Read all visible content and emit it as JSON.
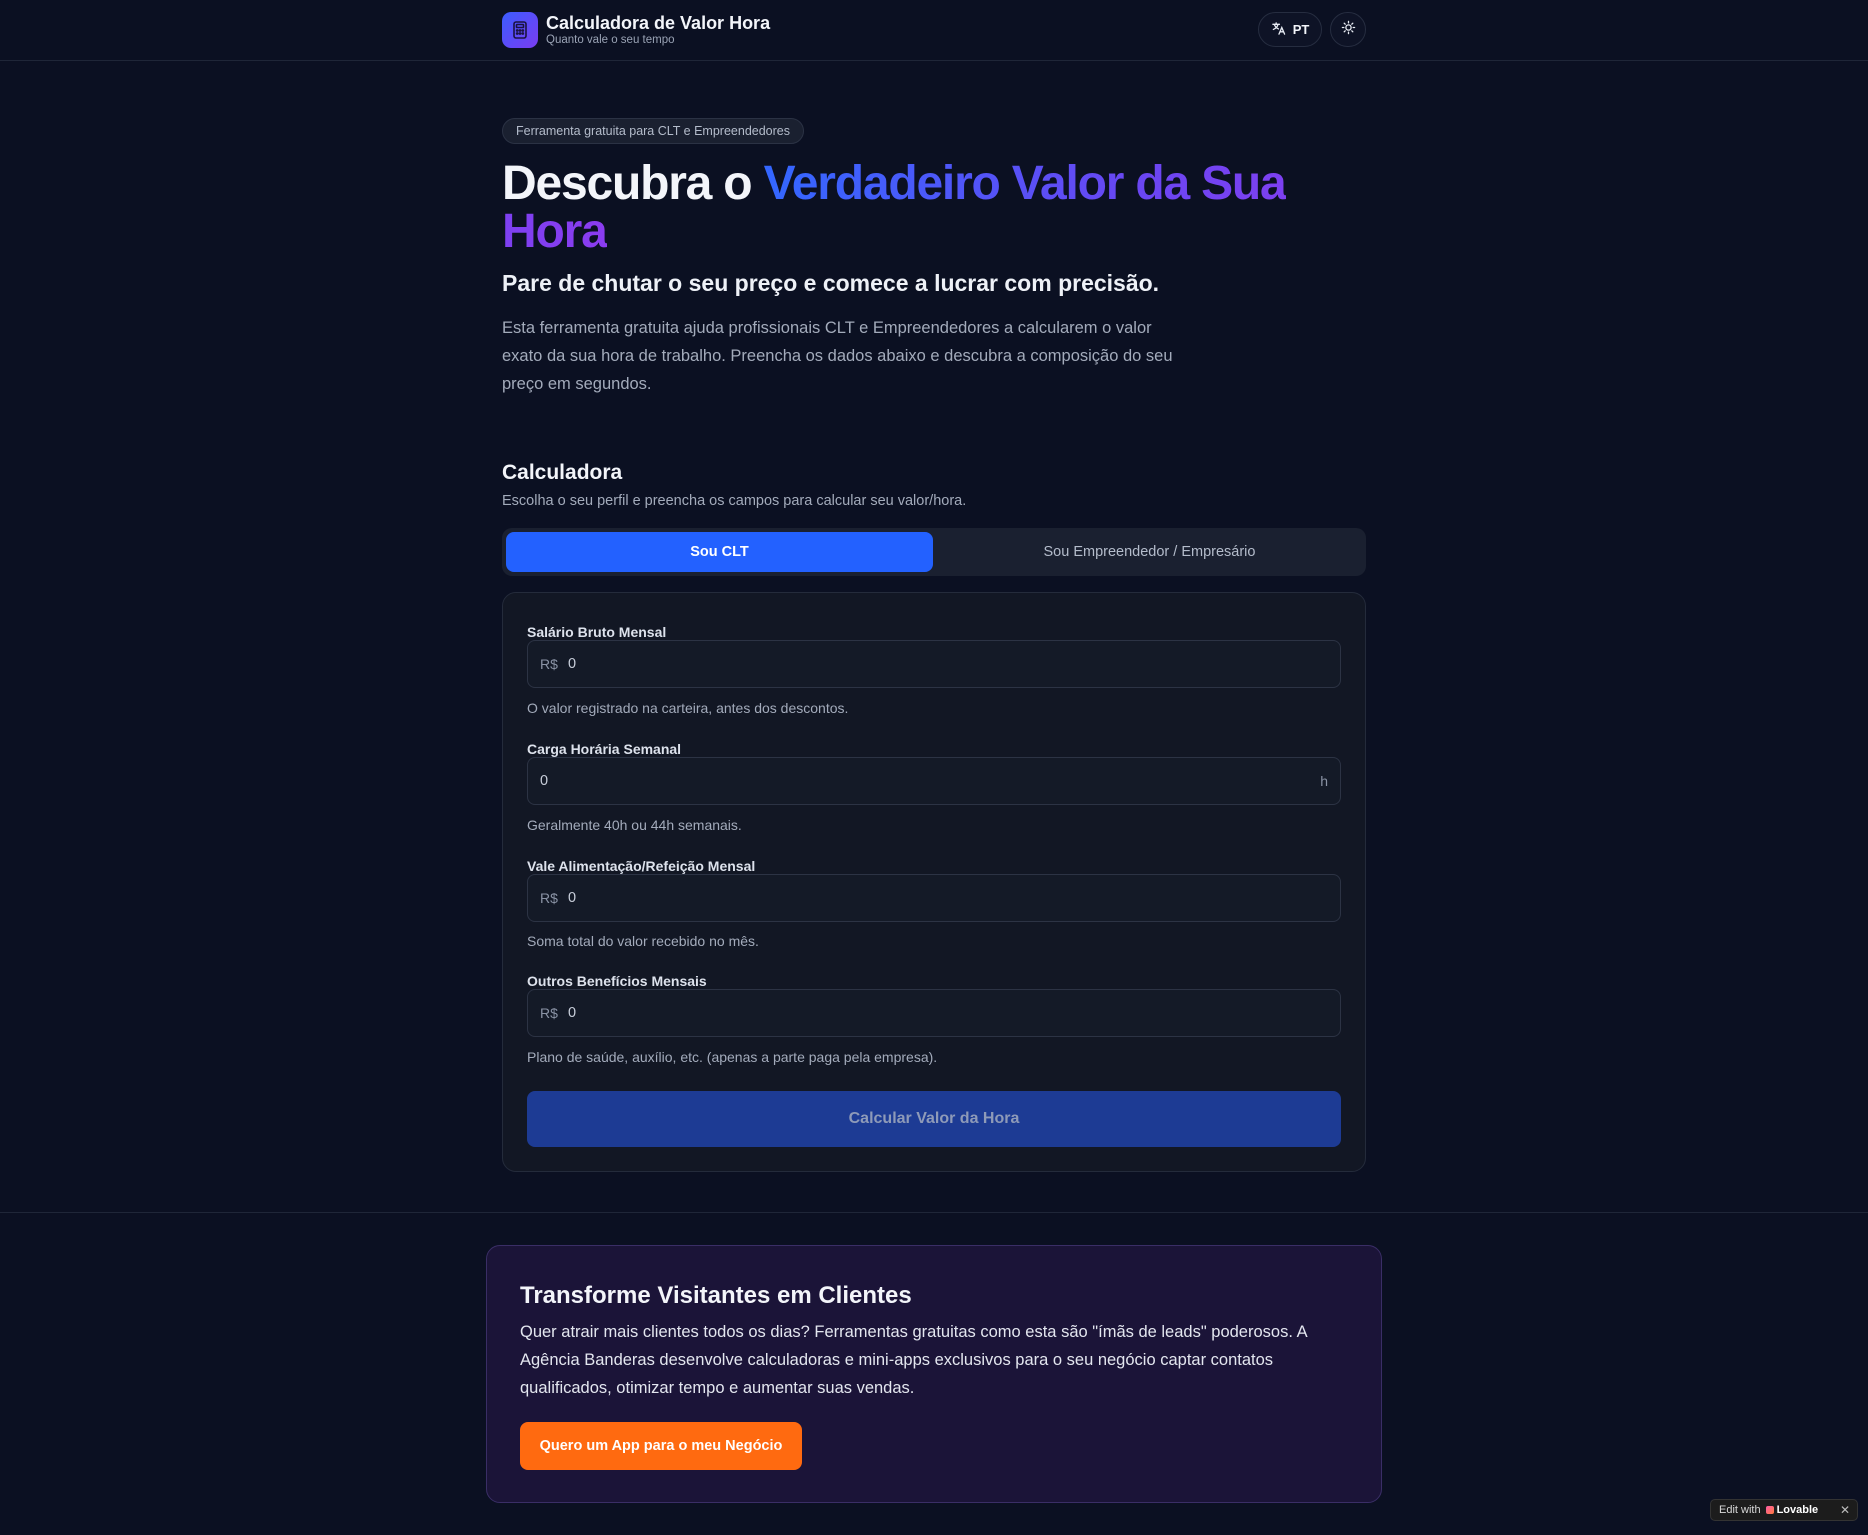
{
  "header": {
    "title": "Calculadora de Valor Hora",
    "subtitle": "Quanto vale o seu tempo",
    "language": "PT"
  },
  "hero": {
    "pill": "Ferramenta gratuita para CLT e Empreendedores",
    "title_plain": "Descubra o ",
    "title_gradient": "Verdadeiro Valor da Sua Hora",
    "subtitle": "Pare de chutar o seu preço e comece a lucrar com precisão.",
    "description": "Esta ferramenta gratuita ajuda profissionais CLT e Empreendedores a calcularem o valor exato da sua hora de trabalho. Preencha os dados abaixo e descubra a composição do seu preço em segundos."
  },
  "calculator": {
    "title": "Calculadora",
    "subtitle": "Escolha o seu perfil e preencha os campos para calcular seu valor/hora.",
    "tabs": [
      {
        "label": "Sou CLT",
        "active": true
      },
      {
        "label": "Sou Empreendedor / Empresário",
        "active": false
      }
    ],
    "fields": [
      {
        "label": "Salário Bruto Mensal",
        "prefix": "R$",
        "value": "0",
        "suffix": "",
        "help": "O valor registrado na carteira, antes dos descontos."
      },
      {
        "label": "Carga Horária Semanal",
        "prefix": "",
        "value": "0",
        "suffix": "h",
        "help": "Geralmente 40h ou 44h semanais."
      },
      {
        "label": "Vale Alimentação/Refeição Mensal",
        "prefix": "R$",
        "value": "0",
        "suffix": "",
        "help": "Soma total do valor recebido no mês."
      },
      {
        "label": "Outros Benefícios Mensais",
        "prefix": "R$",
        "value": "0",
        "suffix": "",
        "help": "Plano de saúde, auxílio, etc. (apenas a parte paga pela empresa)."
      }
    ],
    "submit_label": "Calcular Valor da Hora"
  },
  "promo": {
    "title": "Transforme Visitantes em Clientes",
    "text": "Quer atrair mais clientes todos os dias? Ferramentas gratuitas como esta são \"ímãs de leads\" poderosos. A Agência Banderas desenvolve calculadoras e mini-apps exclusivos para o seu negócio captar contatos qualificados, otimizar tempo e aumentar suas vendas.",
    "button_label": "Quero um App para o meu Negócio"
  },
  "badge": {
    "prefix": "Edit with",
    "brand": "Lovable",
    "close": "✕"
  },
  "colors": {
    "background": "#0b1022",
    "accent_blue": "#2361ff",
    "gradient_start": "#3367ff",
    "gradient_end": "#8b3cf0",
    "cta_orange": "#ff6a10"
  },
  "icons": {
    "logo": "calculator-icon",
    "language": "translate-icon",
    "theme": "sun-icon"
  }
}
